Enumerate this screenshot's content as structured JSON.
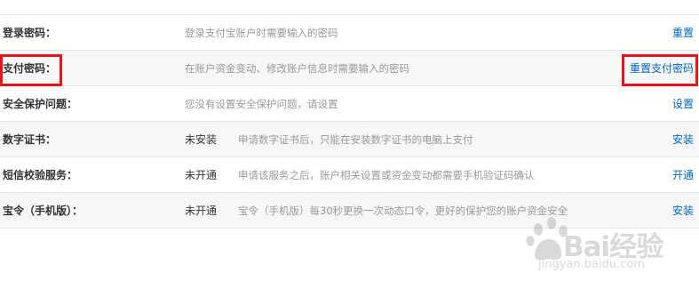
{
  "security_settings": {
    "rows": [
      {
        "label": "登录密码：",
        "status": "",
        "description": "登录支付宝账户时需要输入的密码",
        "action": "重置"
      },
      {
        "label": "支付密码：",
        "status": "",
        "description": "在账户资金变动、修改账户信息时需要输入的密码",
        "action": "重置支付密码"
      },
      {
        "label": "安全保护问题：",
        "status": "",
        "description": "您没有设置安全保护问题，请设置",
        "action": "设置"
      },
      {
        "label": "数字证书：",
        "status": "未安装",
        "description": "申请数字证书后，只能在安装数字证书的电脑上支付",
        "action": "安装"
      },
      {
        "label": "短信校验服务：",
        "status": "未开通",
        "description": "申请该服务之后，账户相关设置或资金变动都需要手机验证码确认",
        "action": "开通"
      },
      {
        "label": "宝令（手机版）：",
        "status": "未开通",
        "description": "宝令（手机版）每30秒更换一次动态口令，更好的保护您的账户资金安全",
        "action": "安装"
      }
    ]
  },
  "highlight_color": "#e8141c",
  "link_color": "#0066cc",
  "watermark": {
    "logo_text": "Bai经验",
    "url_text": "jingyan.baidu.com"
  }
}
